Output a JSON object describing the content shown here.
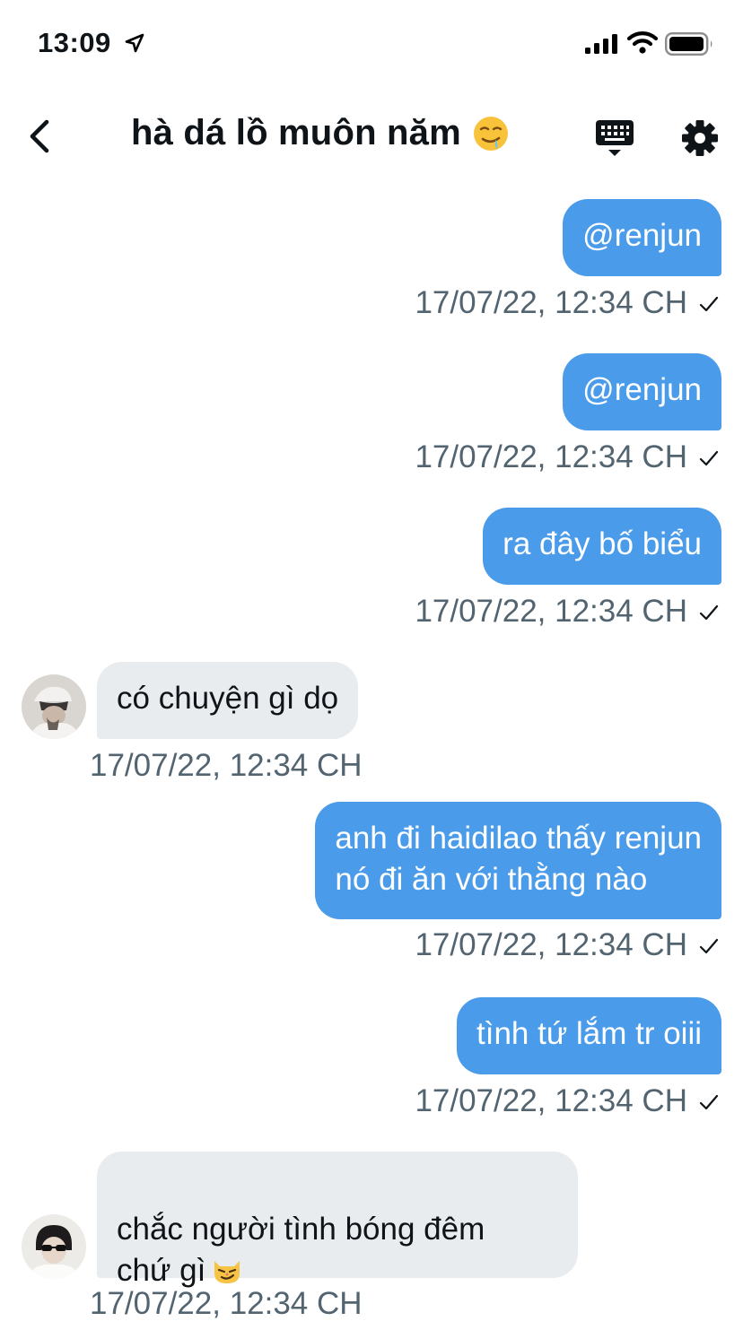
{
  "status_bar": {
    "time": "13:09"
  },
  "nav": {
    "title": "hà dá lồ muôn năm"
  },
  "messages": [
    {
      "direction": "outgoing",
      "text": "@renjun",
      "timestamp": "17/07/22, 12:34 CH"
    },
    {
      "direction": "outgoing",
      "text": "@renjun",
      "timestamp": "17/07/22, 12:34 CH"
    },
    {
      "direction": "outgoing",
      "text": "ra đây bố biểu",
      "timestamp": "17/07/22, 12:34 CH"
    },
    {
      "direction": "incoming",
      "text": "có chuyện gì dọ",
      "timestamp": "17/07/22, 12:34 CH"
    },
    {
      "direction": "outgoing",
      "text": "anh đi haidilao thấy renjun\nnó đi ăn với thằng nào",
      "timestamp": "17/07/22, 12:34 CH"
    },
    {
      "direction": "outgoing",
      "text": "tình tứ lắm tr oiii",
      "timestamp": "17/07/22, 12:34 CH"
    },
    {
      "direction": "incoming",
      "text": "chắc người tình bóng đêm\nchứ gì",
      "timestamp": "17/07/22, 12:34 CH"
    }
  ],
  "colors": {
    "outgoing_bubble": "#4a9be9",
    "incoming_bubble": "#e8ecef",
    "timestamp": "#536471"
  },
  "icons": [
    "location-arrow-icon",
    "signal-icon",
    "wifi-icon",
    "battery-icon",
    "back-chevron-icon",
    "drooling-face-emoji",
    "keyboard-icon",
    "gear-icon",
    "check-icon",
    "smirking-cat-emoji"
  ]
}
